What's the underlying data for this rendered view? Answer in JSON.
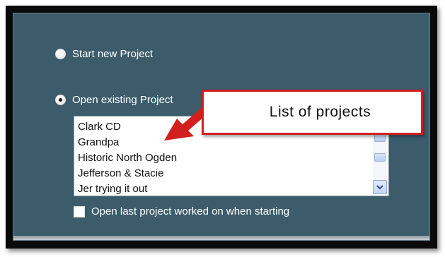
{
  "options": {
    "start_new": {
      "label": "Start new Project",
      "selected": false
    },
    "open_existing": {
      "label": "Open existing Project",
      "selected": true
    }
  },
  "projects": {
    "items": [
      "Clark CD",
      "Grandpa",
      "Historic North Ogden",
      "Jefferson & Stacie",
      "Jer trying it out"
    ]
  },
  "open_last": {
    "label": "Open last project worked on when starting",
    "checked": false
  },
  "callout": {
    "text": "List of projects"
  },
  "colors": {
    "panel_background": "#3c5c6c",
    "callout_border": "#d21f1f",
    "arrow": "#d21f1f"
  },
  "icons": {
    "scroll_down": "chevron-down-icon"
  }
}
